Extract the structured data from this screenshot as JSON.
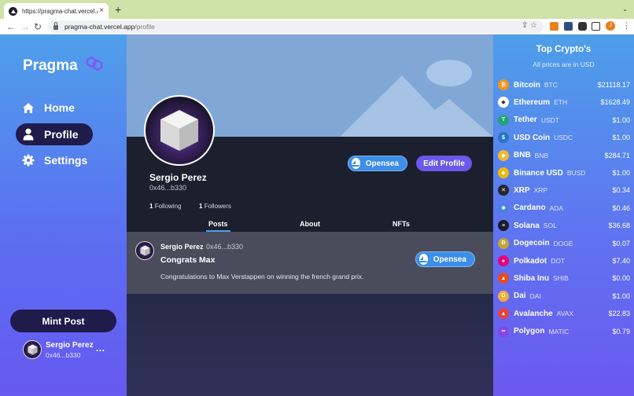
{
  "browser": {
    "tab_title": "https://pragma-chat.vercel.app",
    "tab_close": "×",
    "new_tab": "+",
    "url_host": "pragma-chat.vercel.app",
    "url_path": "/profile",
    "avatar_initial": "J"
  },
  "sidebar": {
    "brand": "Pragma",
    "nav": [
      {
        "label": "Home",
        "icon": "home-icon"
      },
      {
        "label": "Profile",
        "icon": "user-icon",
        "active": true
      },
      {
        "label": "Settings",
        "icon": "gear-icon"
      }
    ],
    "mint_label": "Mint Post",
    "user": {
      "name": "Sergio Perez",
      "address": "0x46...b330",
      "more": "..."
    }
  },
  "profile": {
    "name": "Sergio Perez",
    "address": "0x46...b330",
    "following_count": "1",
    "following_label": "Following",
    "followers_count": "1",
    "followers_label": "Followers",
    "opensea_label": "Opensea",
    "edit_label": "Edit Profile",
    "tabs": [
      "Posts",
      "About",
      "NFTs"
    ],
    "active_tab": "Posts"
  },
  "post": {
    "author": "Sergio Perez",
    "address": "0x46...b330",
    "title": "Congrats Max",
    "body": "Congratulations to Max Verstappen on winning the french grand prix.",
    "opensea_label": "Opensea"
  },
  "crypto": {
    "title": "Top Crypto's",
    "subtitle": "All prices are in USD",
    "coins": [
      {
        "name": "Bitcoin",
        "symbol": "BTC",
        "price": "$21118.17",
        "color": "#f7931a",
        "glyph": "₿"
      },
      {
        "name": "Ethereum",
        "symbol": "ETH",
        "price": "$1628.49",
        "color": "#ffffff",
        "glyph": "◆"
      },
      {
        "name": "Tether",
        "symbol": "USDT",
        "price": "$1.00",
        "color": "#26a17b",
        "glyph": "T"
      },
      {
        "name": "USD Coin",
        "symbol": "USDC",
        "price": "$1.00",
        "color": "#2775ca",
        "glyph": "$"
      },
      {
        "name": "BNB",
        "symbol": "BNB",
        "price": "$284.71",
        "color": "#f3ba2f",
        "glyph": "◆"
      },
      {
        "name": "Binance USD",
        "symbol": "BUSD",
        "price": "$1.00",
        "color": "#f0b90b",
        "glyph": "◆"
      },
      {
        "name": "XRP",
        "symbol": "XRP",
        "price": "$0.34",
        "color": "#23292f",
        "glyph": "✕"
      },
      {
        "name": "Cardano",
        "symbol": "ADA",
        "price": "$0.46",
        "color": "#4a7fe3",
        "glyph": "✺"
      },
      {
        "name": "Solana",
        "symbol": "SOL",
        "price": "$36.68",
        "color": "#1b1b2e",
        "glyph": "≡"
      },
      {
        "name": "Dogecoin",
        "symbol": "DOGE",
        "price": "$0.07",
        "color": "#c2a633",
        "glyph": "Ð"
      },
      {
        "name": "Polkadot",
        "symbol": "DOT",
        "price": "$7.40",
        "color": "#e6007a",
        "glyph": "●"
      },
      {
        "name": "Shiba Inu",
        "symbol": "SHIB",
        "price": "$0.00",
        "color": "#e44d26",
        "glyph": "▲"
      },
      {
        "name": "Dai",
        "symbol": "DAI",
        "price": "$1.00",
        "color": "#f5ac37",
        "glyph": "D"
      },
      {
        "name": "Avalanche",
        "symbol": "AVAX",
        "price": "$22.83",
        "color": "#e84142",
        "glyph": "▲"
      },
      {
        "name": "Polygon",
        "symbol": "MATIC",
        "price": "$0.79",
        "color": "#8247e5",
        "glyph": "∞"
      }
    ]
  }
}
